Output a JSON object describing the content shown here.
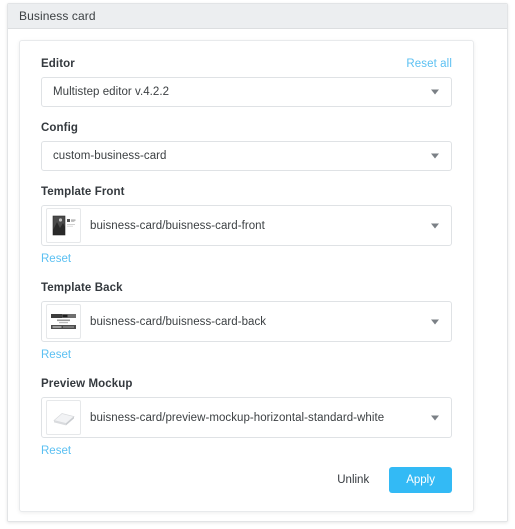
{
  "window": {
    "title": "Business card"
  },
  "form": {
    "reset_all_label": "Reset all",
    "fields": [
      {
        "label": "Editor",
        "value": "Multistep editor v.4.2.2",
        "has_thumb": false,
        "has_reset": false
      },
      {
        "label": "Config",
        "value": "custom-business-card",
        "has_thumb": false,
        "has_reset": false
      },
      {
        "label": "Template Front",
        "value": "buisness-card/buisness-card-front",
        "has_thumb": true,
        "thumb": "business-card-front-thumbnail",
        "has_reset": true,
        "reset_label": "Reset"
      },
      {
        "label": "Template Back",
        "value": "buisness-card/buisness-card-back",
        "has_thumb": true,
        "thumb": "business-card-back-thumbnail",
        "has_reset": true,
        "reset_label": "Reset"
      },
      {
        "label": "Preview Mockup",
        "value": "buisness-card/preview-mockup-horizontal-standard-white",
        "has_thumb": true,
        "thumb": "preview-mockup-thumbnail",
        "has_reset": true,
        "reset_label": "Reset"
      }
    ]
  },
  "footer": {
    "unlink_label": "Unlink",
    "apply_label": "Apply"
  },
  "colors": {
    "accent": "#33baf5",
    "link": "#5bc0f2",
    "titlebar": "#eceef0",
    "text": "#34393e",
    "border": "#dfe2e5"
  }
}
